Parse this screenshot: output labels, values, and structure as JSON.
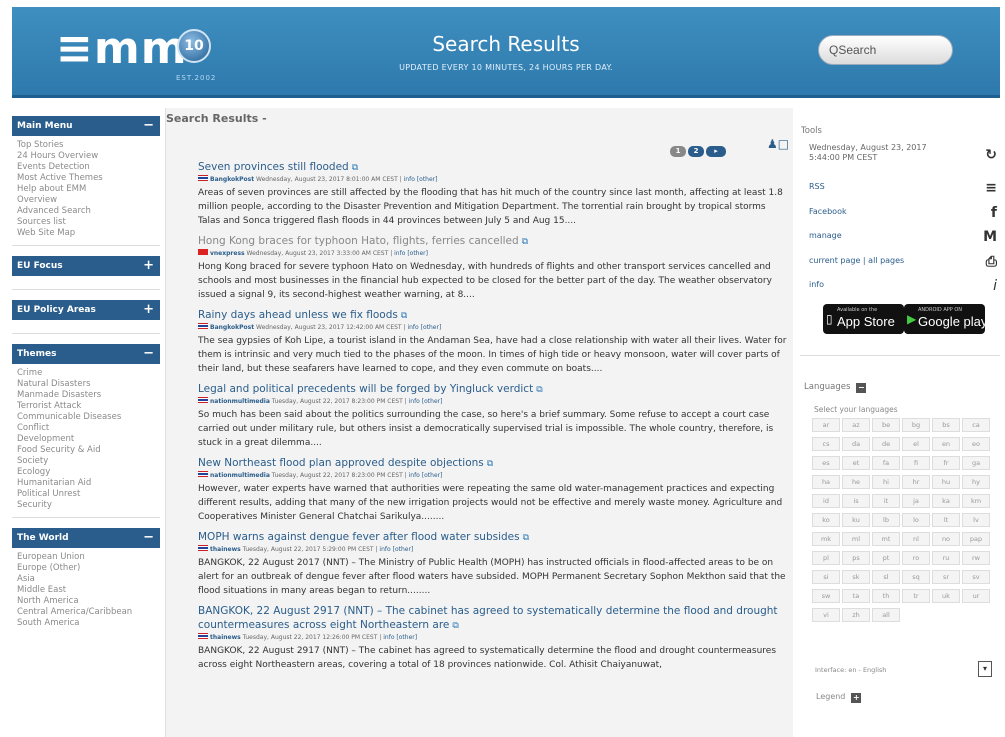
{
  "header": {
    "logo": "≡mm",
    "badge": "10",
    "badge_est": "EST.2002",
    "title": "Search Results",
    "subtitle": "UPDATED EVERY 10 MINUTES, 24 HOURS PER DAY.",
    "search_value": "QSearch"
  },
  "sidebar": {
    "main_menu": {
      "title": "Main Menu",
      "toggle": "−",
      "items": [
        "Top Stories",
        "24 Hours Overview",
        "Events Detection",
        "Most Active Themes",
        "Help about EMM",
        "Overview",
        "Advanced Search",
        "Sources list",
        "Web Site Map"
      ]
    },
    "eu_focus": {
      "title": "EU Focus",
      "toggle": "+"
    },
    "eu_policy": {
      "title": "EU Policy Areas",
      "toggle": "+"
    },
    "themes": {
      "title": "Themes",
      "toggle": "−",
      "items": [
        "Crime",
        "Natural Disasters",
        "Manmade Disasters",
        "Terrorist Attack",
        "Communicable Diseases",
        "Conflict",
        "Development",
        "Food Security & Aid",
        "Society",
        "Ecology",
        "Humanitarian Aid",
        "Political Unrest",
        "Security"
      ]
    },
    "world": {
      "title": "The World",
      "toggle": "−",
      "items": [
        "European Union",
        "Europe (Other)",
        "Asia",
        "Middle East",
        "North America",
        "Central America/Caribbean",
        "South America"
      ]
    }
  },
  "main": {
    "heading": "Search Results -",
    "pager": [
      "1",
      "2",
      "▸"
    ],
    "view_icon": "♟□",
    "articles": [
      {
        "title": "Seven provinces still flooded",
        "flag": "th",
        "source": "BangkokPost",
        "date": "Wednesday, August 23, 2017 8:01:00 AM CEST",
        "info": "info",
        "other": "[other]",
        "body": "Areas of seven provinces are still affected by the flooding that has hit much of the country since last month, affecting at least 1.8 million people, according to the Disaster Prevention and Mitigation Department. The torrential rain brought by tropical storms Talas and Sonca triggered flash floods in 44 provinces between July 5 and Aug 15...."
      },
      {
        "title": "Hong Kong braces for typhoon Hato, flights, ferries cancelled",
        "flag": "vn",
        "source": "vnexpress",
        "date": "Wednesday, August 23, 2017 3:33:00 AM CEST",
        "info": "info",
        "other": "[other]",
        "body": "Hong Kong braced for severe typhoon Hato on Wednesday, with hundreds of flights and other transport services cancelled and schools and most businesses in the financial hub expected to be closed for the better part of the day. The weather observatory issued a signal 9, its second-highest weather warning, at 8...."
      },
      {
        "title": "Rainy days ahead unless we fix floods",
        "flag": "th",
        "source": "BangkokPost",
        "date": "Wednesday, August 23, 2017 12:42:00 AM CEST",
        "info": "info",
        "other": "[other]",
        "body": "The sea gypsies of Koh Lipe, a tourist island in the Andaman Sea, have had a close relationship with water all their lives. Water for them is intrinsic and very much tied to the phases of the moon. In times of high tide or heavy monsoon, water will cover parts of their land, but these seafarers have learned to cope, and they even commute on boats...."
      },
      {
        "title": "Legal and political precedents will be forged by Yingluck verdict",
        "flag": "th",
        "source": "nationmultimedia",
        "date": "Tuesday, August 22, 2017 8:23:00 PM CEST",
        "info": "info",
        "other": "[other]",
        "body": "So much has been said about the politics surrounding the case, so here's a brief summary. Some refuse to accept a court case carried out under military rule, but others insist a democratically supervised trial is impossible. The whole country, therefore, is stuck in a great dilemma...."
      },
      {
        "title": "New Northeast flood plan approved despite objections",
        "flag": "th",
        "source": "nationmultimedia",
        "date": "Tuesday, August 22, 2017 8:23:00 PM CEST",
        "info": "info",
        "other": "[other]",
        "body": "However, water experts have warned that authorities were repeating the same old water-management practices and expecting different results, adding that many of the new irrigation projects would not be effective and merely waste money. Agriculture and Cooperatives Minister General Chatchai Sarikulya........"
      },
      {
        "title": "MOPH warns against dengue fever after flood water subsides",
        "flag": "th",
        "source": "thainews",
        "date": "Tuesday, August 22, 2017 5:29:00 PM CEST",
        "info": "info",
        "other": "[other]",
        "body": "BANGKOK, 22 August 2017 (NNT) – The Ministry of Public Health (MOPH) has instructed officials in flood-affected areas to be on alert for an outbreak of dengue fever after flood waters have subsided. MOPH Permanent Secretary Sophon Mekthon said that the flood situations in many areas began to return........"
      },
      {
        "title": "BANGKOK, 22 August 2917 (NNT) – The cabinet has agreed to systematically determine the flood and drought countermeasures across eight Northeastern are",
        "flag": "th",
        "source": "thainews",
        "date": "Tuesday, August 22, 2017 12:26:00 PM CEST",
        "info": "info",
        "other": "[other]",
        "body": "BANGKOK, 22 August 2917 (NNT) – The cabinet has agreed to systematically determine the flood and drought countermeasures across eight Northeastern areas, covering a total of 18 provinces nationwide. Col. Athisit Chaiyanuwat,"
      }
    ]
  },
  "tools": {
    "heading": "Tools",
    "date": "Wednesday, August 23, 2017 5:44:00 PM CEST",
    "rss": "RSS",
    "facebook": "Facebook",
    "manage": "manage",
    "current_page": "current page",
    "all_pages": "all pages",
    "separator": " | ",
    "info": "info",
    "appstore_small": "Available on the",
    "appstore_big": "App Store",
    "googleplay_small": "ANDROID APP ON",
    "googleplay_big": "Google play"
  },
  "languages": {
    "heading": "Languages",
    "prompt": "Select your languages",
    "codes": [
      "ar",
      "az",
      "be",
      "bg",
      "bs",
      "ca",
      "cs",
      "da",
      "de",
      "el",
      "en",
      "eo",
      "es",
      "et",
      "fa",
      "fi",
      "fr",
      "ga",
      "ha",
      "he",
      "hi",
      "hr",
      "hu",
      "hy",
      "id",
      "is",
      "it",
      "ja",
      "ka",
      "km",
      "ko",
      "ku",
      "lb",
      "lo",
      "lt",
      "lv",
      "mk",
      "ml",
      "mt",
      "nl",
      "no",
      "pap",
      "pl",
      "ps",
      "pt",
      "ro",
      "ru",
      "rw",
      "si",
      "sk",
      "sl",
      "sq",
      "sr",
      "sv",
      "sw",
      "ta",
      "th",
      "tr",
      "uk",
      "ur",
      "vi",
      "zh",
      "all"
    ],
    "interface_label": "Interface: en - English",
    "legend": "Legend"
  },
  "colors": {
    "header_blue": "#3f8fc0",
    "menu_header": "#2a5d8b",
    "link": "#2a5d8b"
  }
}
